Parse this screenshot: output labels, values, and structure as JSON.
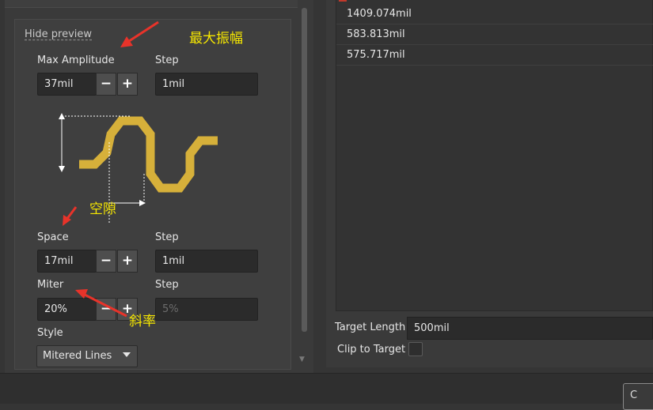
{
  "left": {
    "hide_preview": "Hide preview",
    "max_amplitude_label": "Max Amplitude",
    "max_amplitude_value": "37mil",
    "amp_step_label": "Step",
    "amp_step_value": "1mil",
    "space_label": "Space",
    "space_value": "17mil",
    "space_step_label": "Step",
    "space_step_value": "1mil",
    "miter_label": "Miter",
    "miter_value": "20%",
    "miter_step_label": "Step",
    "miter_step_value": "5%",
    "style_label": "Style",
    "style_value": "Mitered Lines",
    "minus": "−",
    "plus": "+"
  },
  "annotations": {
    "amplitude": "最大振幅",
    "gap": "空隙",
    "slope": "斜率"
  },
  "right": {
    "rows": [
      "1409.074mil",
      "583.813mil",
      "575.717mil"
    ],
    "target_length_label": "Target Length",
    "target_length_value": "500mil",
    "clip_label": "Clip to Target"
  },
  "bottom": {
    "button_label": "C"
  },
  "colors": {
    "trace": "#d6b03a",
    "annotation_text": "#f5e600",
    "arrow": "#e8332a"
  }
}
